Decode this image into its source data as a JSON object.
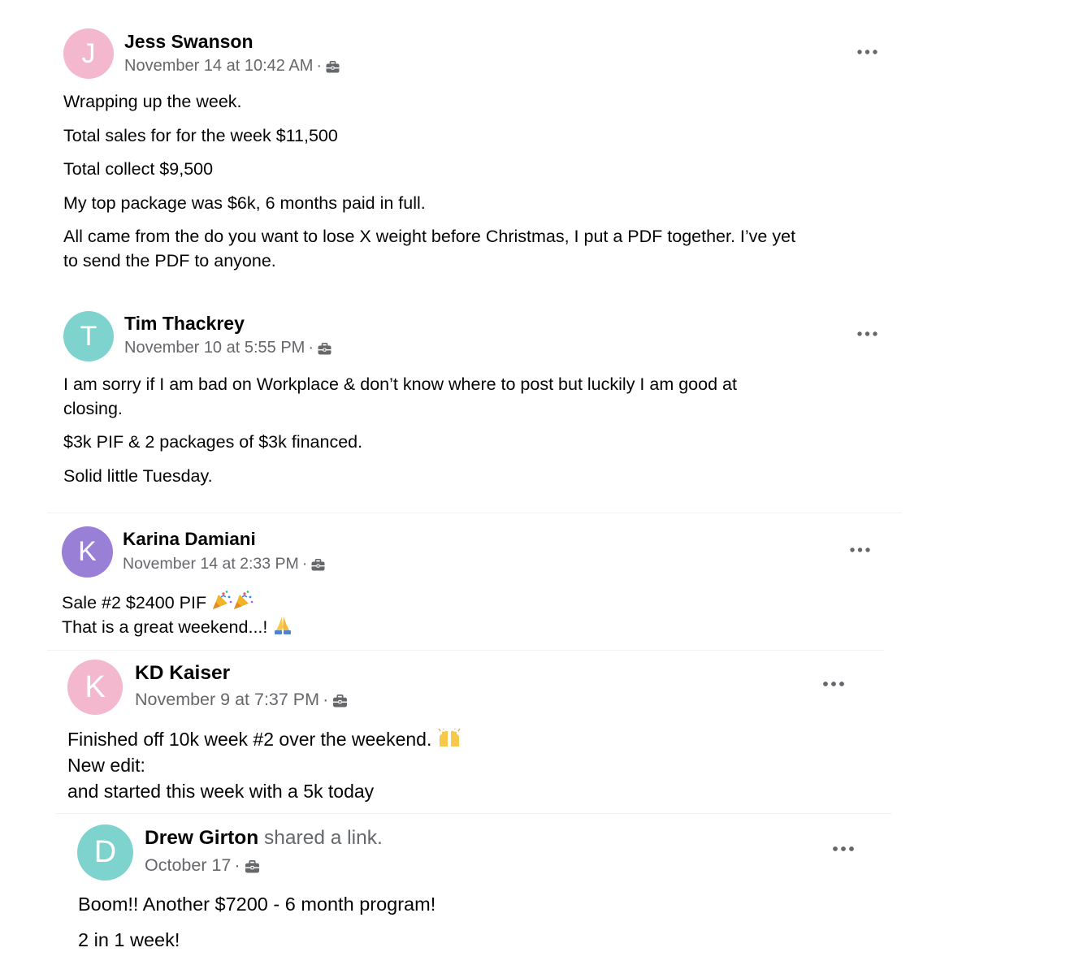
{
  "posts": [
    {
      "author": "Jess Swanson",
      "avatar_letter": "J",
      "avatar_color": "#f3b8cd",
      "timestamp": "November 14 at 10:42 AM",
      "lines": [
        "Wrapping up the week.",
        "Total sales for for the week $11,500",
        "Total collect $9,500",
        "My top package was $6k, 6 months paid in full.",
        "All came from the do you want to lose X weight before Christmas, I put a PDF together. I’ve yet",
        "to send the PDF to anyone."
      ]
    },
    {
      "author": "Tim Thackrey",
      "avatar_letter": "T",
      "avatar_color": "#7fd3cf",
      "timestamp": "November 10 at 5:55 PM",
      "lines": [
        "I am sorry if I am bad on Workplace & don’t know where to post but luckily I am good at",
        "closing.",
        "$3k PIF & 2 packages of $3k financed.",
        "Solid little Tuesday."
      ]
    },
    {
      "author": "Karina Damiani",
      "avatar_letter": "K",
      "avatar_color": "#9a7fd6",
      "timestamp": "November 14 at 2:33 PM",
      "lines": [
        "Sale #2 $2400 PIF",
        "That is a great weekend...!"
      ]
    },
    {
      "author": "KD Kaiser",
      "avatar_letter": "K",
      "avatar_color": "#f3b8cd",
      "timestamp": "November 9 at 7:37 PM",
      "lines": [
        "Finished off 10k week #2 over the weekend.",
        "New edit:",
        "and started this week with a 5k today"
      ]
    },
    {
      "author": "Drew Girton",
      "action": "shared a link.",
      "avatar_letter": "D",
      "avatar_color": "#7fd3cf",
      "timestamp": "October 17",
      "lines": [
        "Boom!! Another $7200 - 6 month program!",
        "2 in 1 week!"
      ]
    }
  ],
  "meta_separator": "·",
  "icons": {
    "audience": "briefcase-icon",
    "more": "more-options-icon",
    "party": "party-popper-emoji",
    "pray": "folded-hands-emoji",
    "raise": "raising-hands-emoji"
  }
}
